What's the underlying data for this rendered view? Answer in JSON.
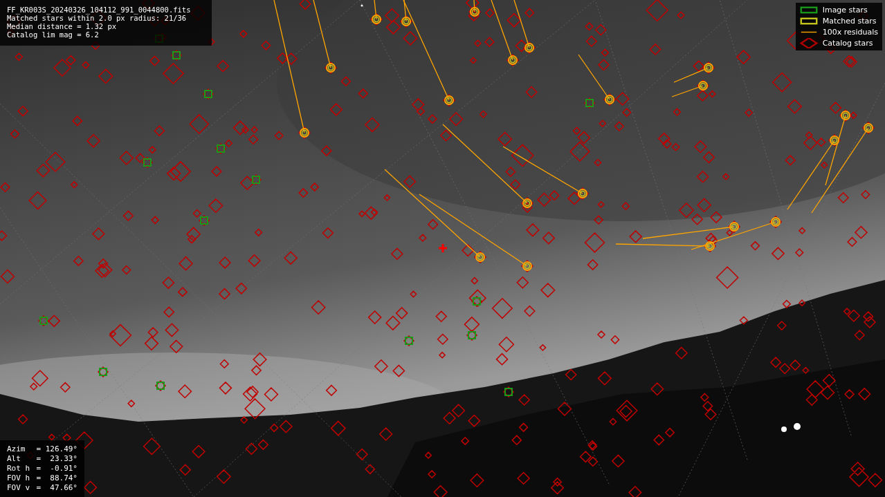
{
  "info": {
    "lines": [
      "FF_KR003S_20240326_104112_991_0044800.fits",
      "Matched stars within 2.0 px radius: 21/36",
      "Median distance = 1.32 px",
      "Catalog lim mag = 6.2"
    ]
  },
  "legend": [
    {
      "label": "Image stars",
      "color": "#1a9a1a"
    },
    {
      "kind": "matched",
      "label": "Matched stars",
      "color": "#c8c81e"
    },
    {
      "kind": "residual",
      "label": "100x residuals",
      "color": "#ffa500"
    },
    {
      "kind": "catalog",
      "label": "Catalog stars",
      "color": "#b00000"
    }
  ],
  "pointing": [
    {
      "label": "Azim",
      "value": "= 126.49°"
    },
    {
      "label": "Alt",
      "value": "=  23.33°"
    },
    {
      "label": "Rot h",
      "value": "=  -0.91°"
    },
    {
      "label": "FOV h",
      "value": "=  88.74°"
    },
    {
      "label": "FOV v",
      "value": "=  47.66°"
    }
  ]
}
